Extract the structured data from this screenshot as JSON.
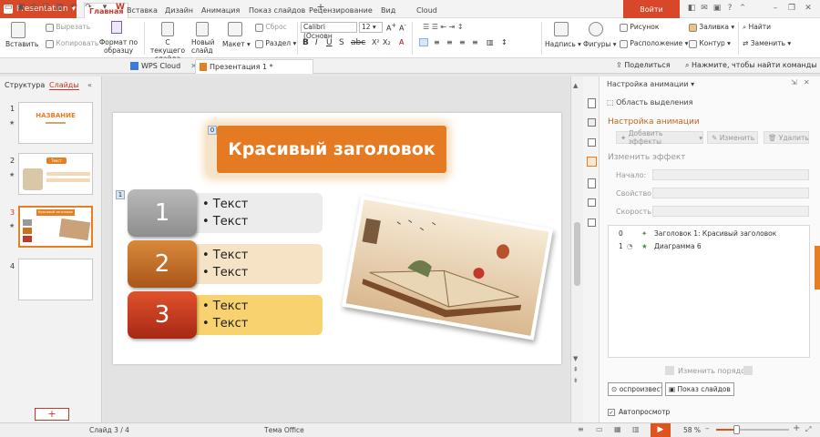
{
  "app": {
    "menu_label": "Presentation",
    "login_label": "Войти"
  },
  "tabs": [
    "Главная",
    "Вставка",
    "Дизайн",
    "Анимация",
    "Показ слайдов",
    "Рецензирование",
    "Вид",
    "Cloud"
  ],
  "ribbon": {
    "paste": "Вставить",
    "cut": "Вырезать",
    "copy": "Копировать",
    "format_painter": "Формат по образцу",
    "from_current": "С текущего слайда",
    "new_slide": "Новый слайд",
    "layout": "Макет",
    "reset": "Сброс",
    "section": "Раздел",
    "font_name": "Calibri (Основн",
    "font_size": "12",
    "textbox": "Надпись",
    "shapes": "Фигуры",
    "picture": "Рисунок",
    "arrange": "Расположение",
    "fill": "Заливка",
    "outline": "Контур",
    "find": "Найти",
    "replace": "Заменить"
  },
  "quickbar": {
    "wps_cloud": "WPS Cloud",
    "doc_tab": "Презентация 1 *",
    "share": "Поделиться",
    "search_hint": "Нажмите, чтобы найти команды"
  },
  "leftpane": {
    "tab_structure": "Структура",
    "tab_slides": "Слайды",
    "slide_numbers": [
      "1",
      "2",
      "3",
      "4"
    ],
    "thumb1_title": "НАЗВАНИЕ",
    "thumb2_title": "Текст",
    "thumb3_title": "Красивый заголовок"
  },
  "slide": {
    "title": "Красивый заголовок",
    "anim_tag_0": "0",
    "anim_tag_1": "1",
    "rows": [
      {
        "num": "1",
        "lines": [
          "• Текст",
          "• Текст"
        ]
      },
      {
        "num": "2",
        "lines": [
          "• Текст",
          "• Текст"
        ]
      },
      {
        "num": "3",
        "lines": [
          "• Текст",
          "• Текст"
        ]
      }
    ]
  },
  "anim": {
    "header": "Настройка анимации",
    "selection_area": "Область выделения",
    "section_title": "Настройка анимации",
    "add_effects": "Добавить эффекты",
    "change": "Изменить",
    "delete": "Удалить",
    "change_effect": "Изменить эффект",
    "start": "Начало:",
    "property": "Свойство:",
    "speed": "Скорость:",
    "items": [
      {
        "num": "0",
        "text": "Заголовок 1: Красивый заголовок"
      },
      {
        "num": "1",
        "text": "Диаграмма 6"
      }
    ],
    "reorder": "Изменить порядок",
    "play": "оспроизвест",
    "slideshow": "Показ слайдов",
    "autopreview": "Автопросмотр"
  },
  "status": {
    "slide": "Слайд 3 / 4",
    "theme": "Тема Office",
    "zoom": "58 %"
  },
  "colors": {
    "accent": "#d9472b",
    "orange": "#e67e22"
  }
}
